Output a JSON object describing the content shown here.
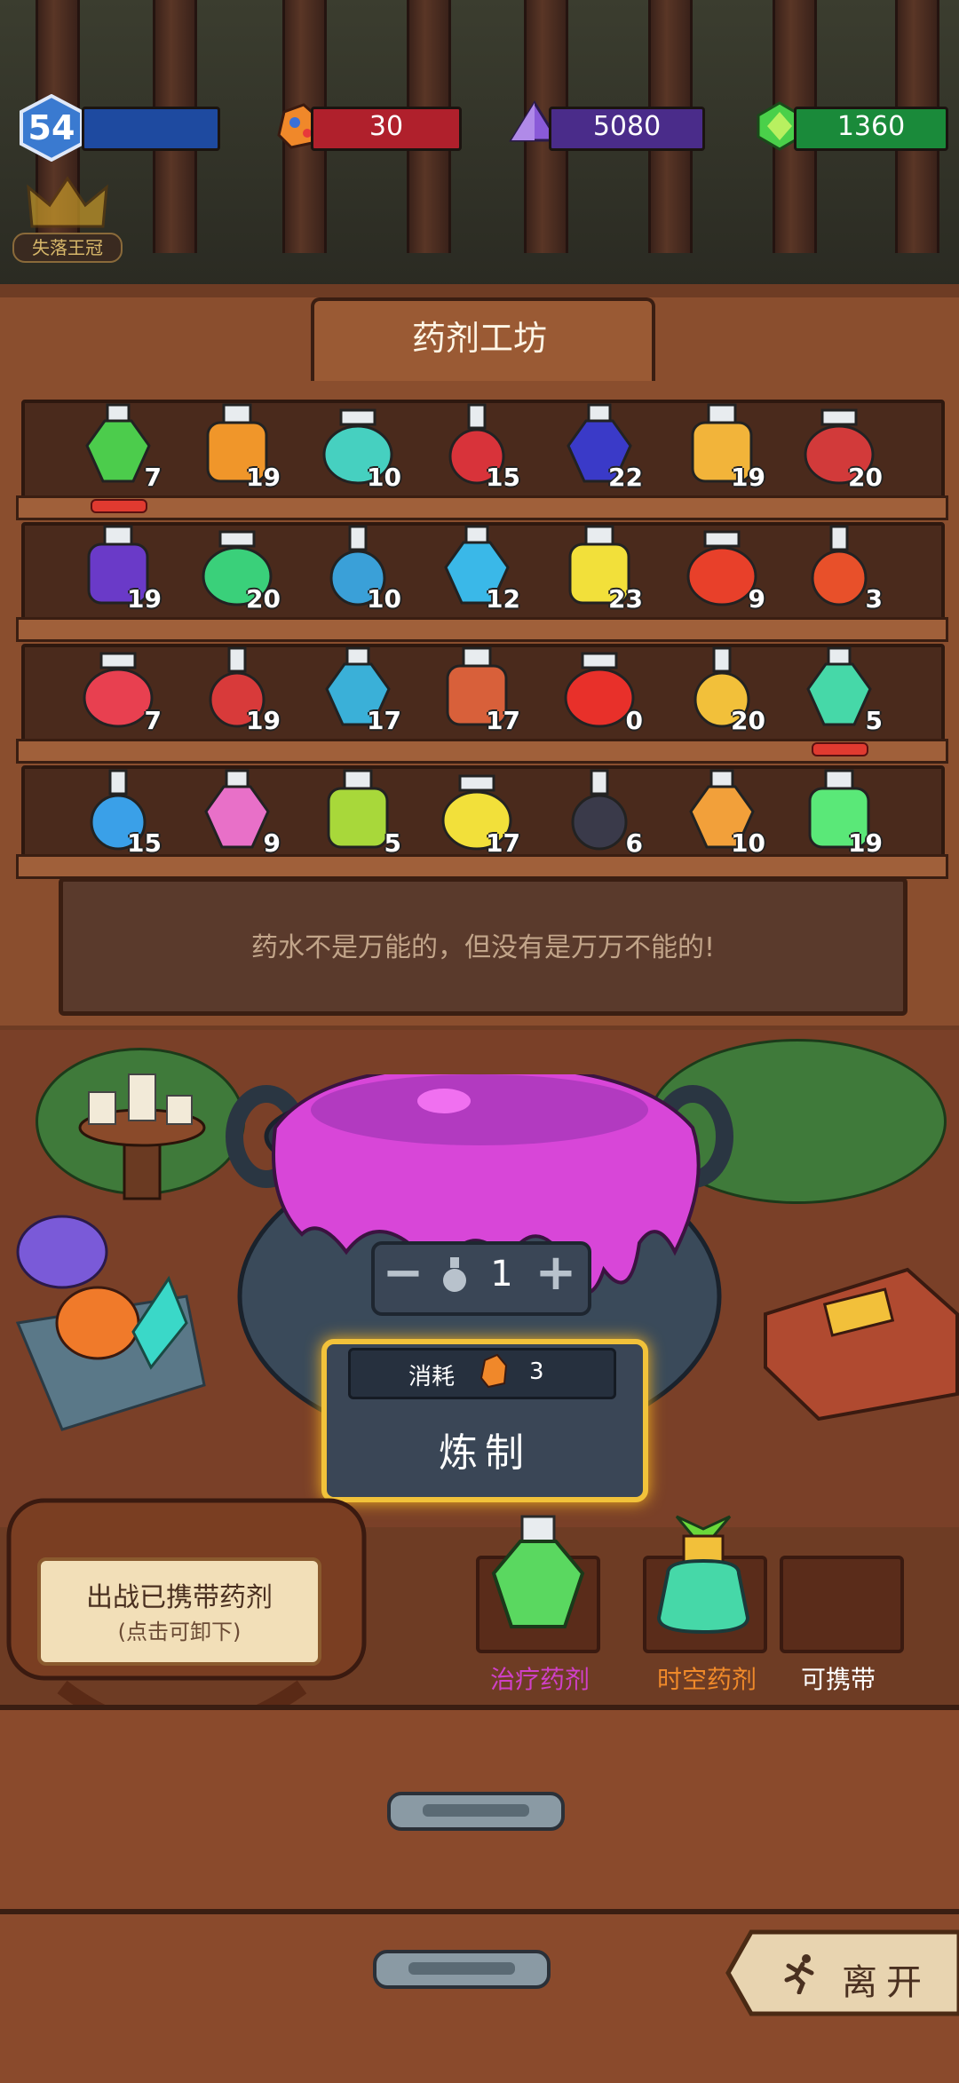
{
  "hud": {
    "level": "54",
    "resources": [
      {
        "name": "ore",
        "value": "30",
        "color": "#b0202c",
        "icon": "ore-icon"
      },
      {
        "name": "crystal",
        "value": "5080",
        "color": "#4a2c8a",
        "icon": "purple-crystal-icon"
      },
      {
        "name": "gem",
        "value": "1360",
        "color": "#1a8a3a",
        "icon": "green-gem-icon"
      }
    ],
    "title_badge": "失落王冠"
  },
  "workshop": {
    "title": "药剂工坊",
    "shelves": [
      [
        {
          "count": "7",
          "color": "#4ccc4c",
          "equipped": true
        },
        {
          "count": "19",
          "color": "#f0962a"
        },
        {
          "count": "10",
          "color": "#46d0c0"
        },
        {
          "count": "15",
          "color": "#d8333a"
        },
        {
          "count": "22",
          "color": "#3a3ac8"
        },
        {
          "count": "19",
          "color": "#f2b43a"
        },
        {
          "count": "20",
          "color": "#d23a3a"
        }
      ],
      [
        {
          "count": "19",
          "color": "#6a3ac8"
        },
        {
          "count": "20",
          "color": "#3ad07a"
        },
        {
          "count": "10",
          "color": "#3aa0d8"
        },
        {
          "count": "12",
          "color": "#3ab8e8"
        },
        {
          "count": "23",
          "color": "#f2e03a"
        },
        {
          "count": "9",
          "color": "#e8402a"
        },
        {
          "count": "3",
          "color": "#e8502a"
        }
      ],
      [
        {
          "count": "7",
          "color": "#e84050"
        },
        {
          "count": "19",
          "color": "#d83a3a"
        },
        {
          "count": "17",
          "color": "#3ab0d8"
        },
        {
          "count": "17",
          "color": "#d8603a"
        },
        {
          "count": "0",
          "color": "#e8302a"
        },
        {
          "count": "20",
          "color": "#f2c03a"
        },
        {
          "count": "5",
          "color": "#46d8a8",
          "equipped": true
        }
      ],
      [
        {
          "count": "15",
          "color": "#3aa0e8"
        },
        {
          "count": "9",
          "color": "#e870c8"
        },
        {
          "count": "5",
          "color": "#a8d83a"
        },
        {
          "count": "17",
          "color": "#f2e03a"
        },
        {
          "count": "6",
          "color": "#3a3a4a"
        },
        {
          "count": "10",
          "color": "#f2a03a"
        },
        {
          "count": "19",
          "color": "#5ae878"
        }
      ]
    ],
    "quote": "药水不是万能的，但没有是万万不能的!"
  },
  "crafting": {
    "quantity": "1",
    "cost_label": "消耗",
    "cost_value": "3",
    "craft_label": "炼制",
    "minus_icon": "minus-icon",
    "plus_icon": "plus-icon"
  },
  "loadout": {
    "bag_title": "出战已携带药剂",
    "bag_subtitle": "(点击可卸下)",
    "slots": [
      {
        "label": "治疗药剂",
        "color": "#d040c8",
        "potion_color": "#5ad860"
      },
      {
        "label": "时空药剂",
        "color": "#f08a2a",
        "potion_color": "#46d8a8"
      },
      {
        "label": "可携带",
        "color": "#ffffff"
      }
    ]
  },
  "footer": {
    "leave_label": "离开",
    "leave_icon": "running-person-icon"
  }
}
